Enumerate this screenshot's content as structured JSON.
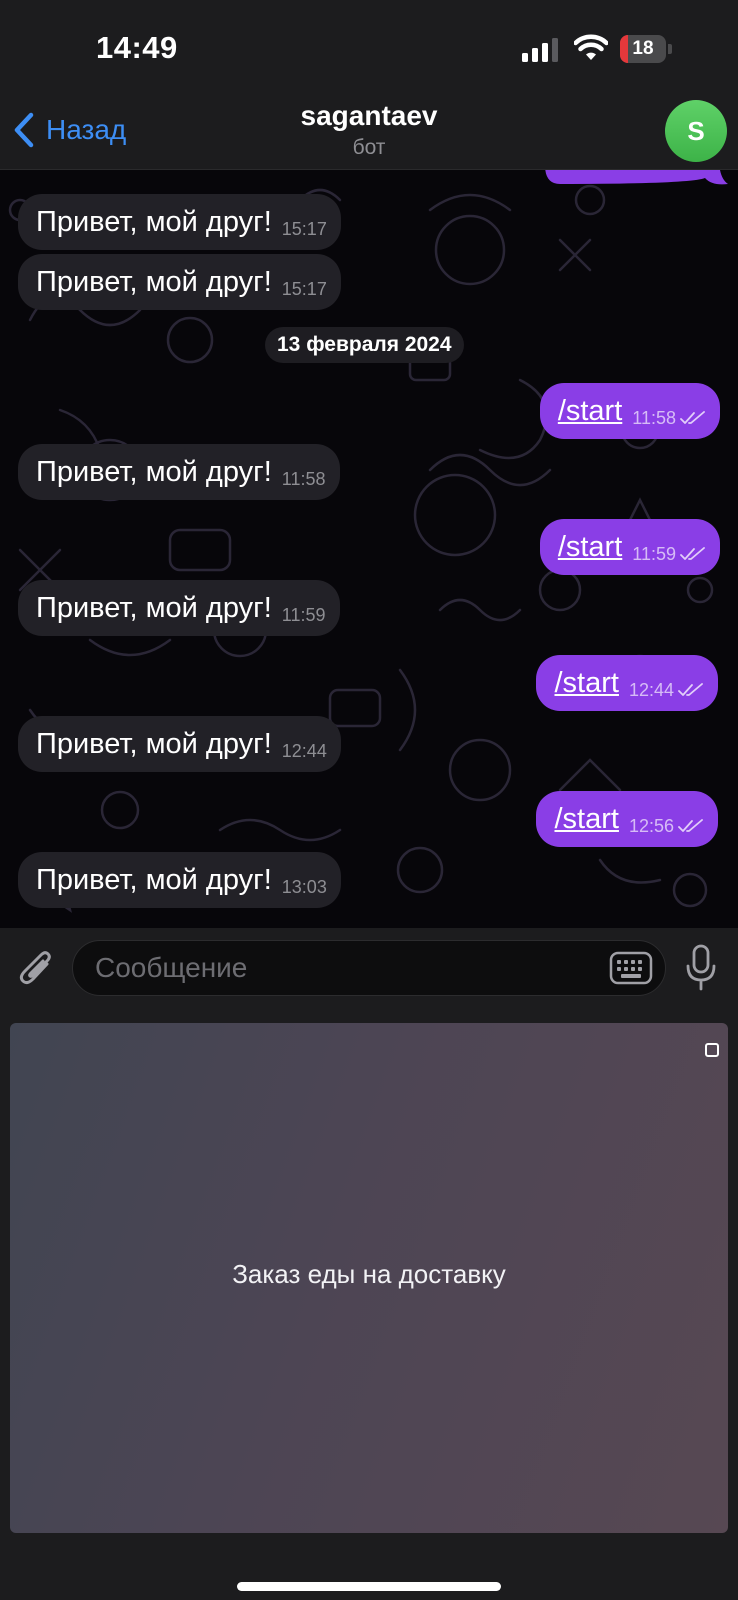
{
  "status_bar": {
    "time": "14:49",
    "battery": "18",
    "battery_level": 0.18,
    "signal_bars": 3,
    "icons": [
      "signal-icon",
      "wifi-icon",
      "battery-icon"
    ]
  },
  "nav": {
    "back_label": "Назад",
    "title": "sagantaev",
    "subtitle": "бот",
    "avatar_letter": "S"
  },
  "chat": {
    "date_separator": "13 февраля 2024",
    "messages": [
      {
        "direction": "in",
        "text": "Привет, мой друг!",
        "time": "15:17"
      },
      {
        "direction": "in",
        "text": "Привет, мой друг!",
        "time": "15:17"
      },
      {
        "direction": "out",
        "text": "/start",
        "time": "11:58",
        "read": true
      },
      {
        "direction": "in",
        "text": "Привет, мой друг!",
        "time": "11:58"
      },
      {
        "direction": "out",
        "text": "/start",
        "time": "11:59",
        "read": true
      },
      {
        "direction": "in",
        "text": "Привет, мой друг!",
        "time": "11:59"
      },
      {
        "direction": "out",
        "text": "/start",
        "time": "12:44",
        "read": true
      },
      {
        "direction": "in",
        "text": "Привет, мой друг!",
        "time": "12:44"
      },
      {
        "direction": "out",
        "text": "/start",
        "time": "12:56",
        "read": true
      },
      {
        "direction": "in",
        "text": "Привет, мой друг!",
        "time": "13:03"
      }
    ]
  },
  "input": {
    "placeholder": "Сообщение",
    "value": ""
  },
  "webapp": {
    "title": "Заказ еды на доставку"
  },
  "colors": {
    "accent": "#3d8ef5",
    "outgoing_bubble": "#8a3ee6",
    "incoming_bubble": "#222127",
    "avatar": "#4cc157",
    "battery_low": "#e5383b"
  }
}
